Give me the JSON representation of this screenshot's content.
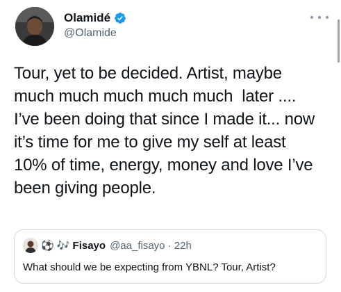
{
  "tweet": {
    "author": {
      "display_name": "Olamidé",
      "handle": "@Olamide",
      "verified": true,
      "avatar_icon": "profile-photo"
    },
    "menu_icon": "more-horizontal-icon",
    "text_lines": [
      "Tour, yet to be decided. Artist, maybe",
      "much much much much much  later ....",
      "I’ve been doing that since I made it... now",
      "it’s time for me to give my self at least",
      "10% of time, energy, money and love I’ve",
      "been giving people."
    ]
  },
  "quote": {
    "name_prefix": "⚽ 🎶",
    "display_name": "Fisayo",
    "handle_time": "@aa_fisayo · 22h",
    "text": "What should we be expecting from YBNL? Tour, Artist?"
  },
  "colors": {
    "text": "#0f1419",
    "secondary": "#536471",
    "verified": "#1d9bf0",
    "border": "#cfd9de"
  }
}
